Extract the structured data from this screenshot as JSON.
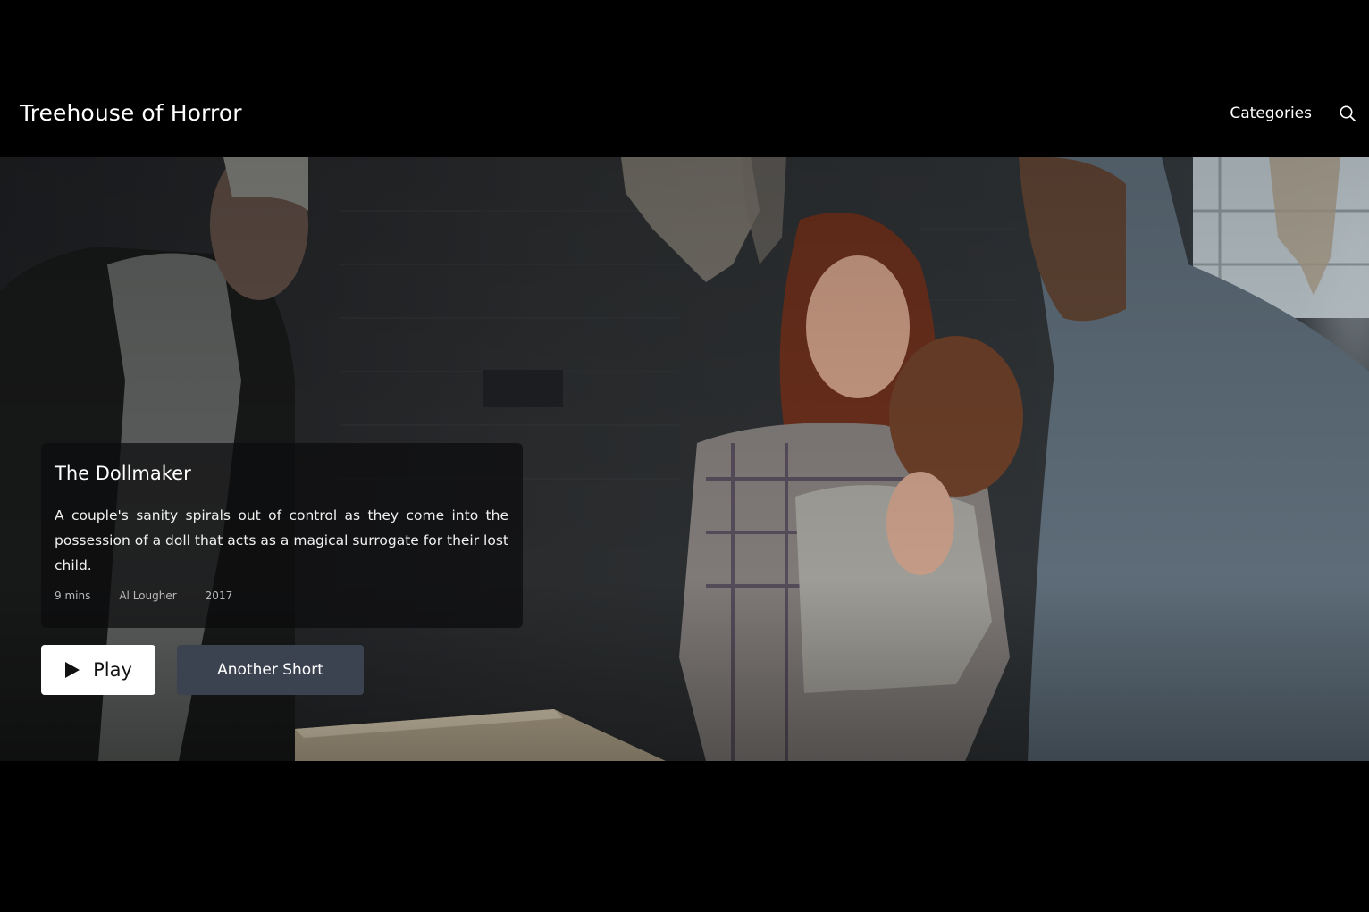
{
  "header": {
    "site_title": "Treehouse of Horror",
    "nav_categories": "Categories",
    "search_icon": "search-icon"
  },
  "featured": {
    "title": "The Dollmaker",
    "description": "A couple's sanity spirals out of control as they come into the possession of a doll that acts as a magical surrogate for their lost child.",
    "meta": {
      "duration": "9 mins",
      "director": "Al Lougher",
      "year": "2017"
    }
  },
  "actions": {
    "play_label": "Play",
    "play_icon": "play-icon",
    "another_label": "Another Short"
  },
  "colors": {
    "background": "#000000",
    "play_button": "#ffffff",
    "another_button": "#3c4350"
  }
}
